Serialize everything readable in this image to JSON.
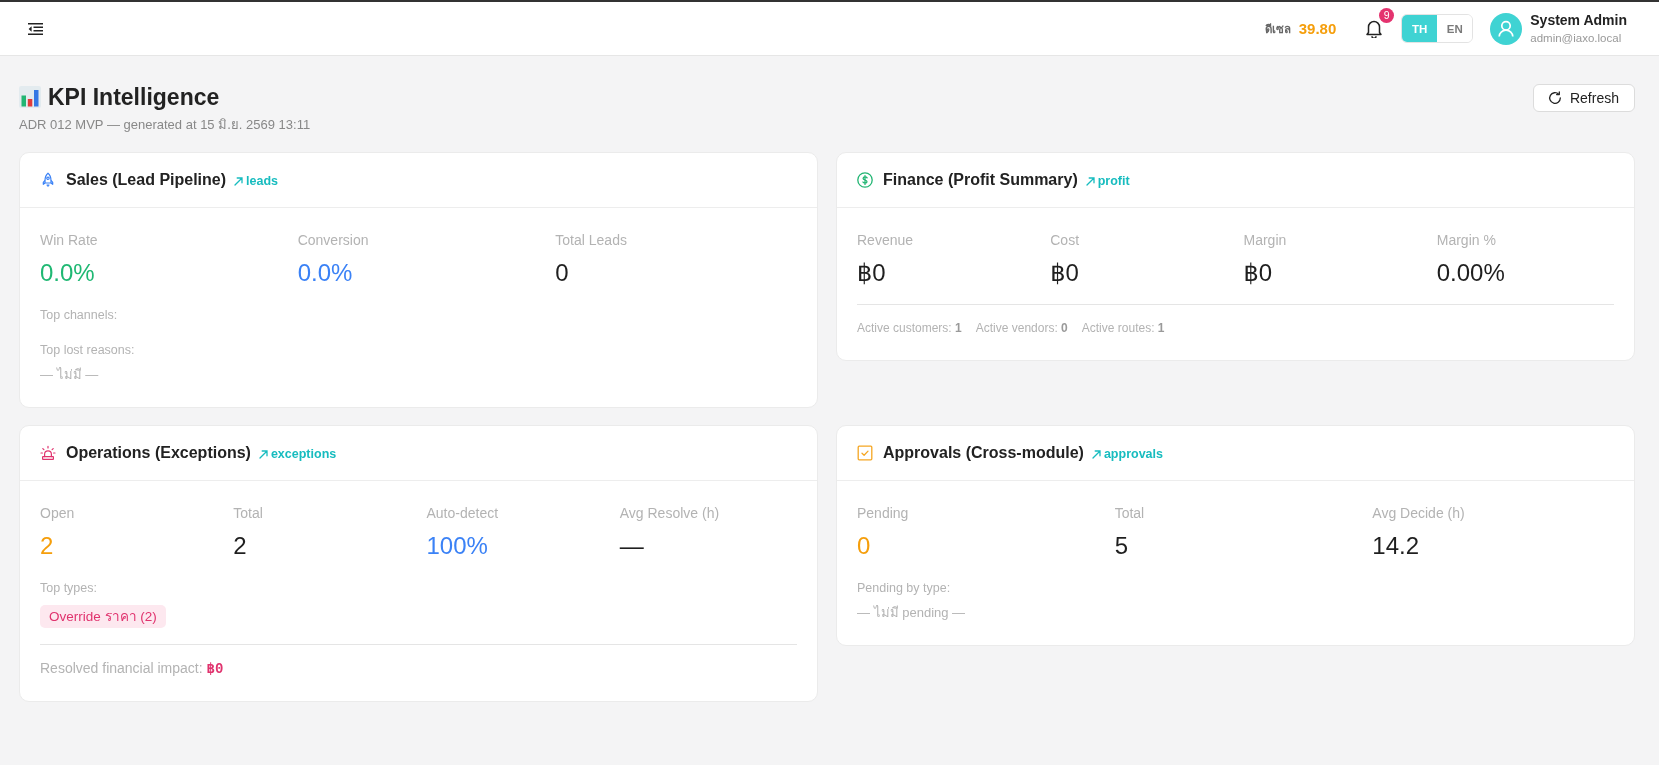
{
  "topbar": {
    "fuel": {
      "label": "ดีเซล",
      "price": "39.80"
    },
    "notifications": {
      "count": "9"
    },
    "languages": [
      {
        "label": "TH",
        "selected": true
      },
      {
        "label": "EN",
        "selected": false
      }
    ],
    "user": {
      "name": "System Admin",
      "email": "admin@iaxo.local"
    }
  },
  "header": {
    "title": "KPI Intelligence",
    "subtitle": "ADR 012 MVP — generated at 15 มิ.ย. 2569 13:11",
    "refresh_button": "Refresh"
  },
  "cards": [
    {
      "kind": "sales",
      "title": "Sales (Lead Pipeline)",
      "link": "leads",
      "metrics": [
        {
          "label": "Win Rate",
          "value": "0.0%",
          "color": "#1fb873"
        },
        {
          "label": "Conversion",
          "value": "0.0%",
          "color": "#3b82f6"
        },
        {
          "label": "Total Leads",
          "value": "0",
          "color": "#1f1f1f"
        }
      ],
      "notes": [
        {
          "kind": "heading",
          "text": "Top channels:"
        },
        {
          "kind": "heading",
          "text": "Top lost reasons:"
        },
        {
          "kind": "empty",
          "text": "— ไม่มี —"
        }
      ]
    },
    {
      "kind": "finance",
      "title": "Finance (Profit Summary)",
      "link": "profit",
      "metrics": [
        {
          "label": "Revenue",
          "value": "฿0",
          "color": "#1f1f1f"
        },
        {
          "label": "Cost",
          "value": "฿0",
          "color": "#1f1f1f"
        },
        {
          "label": "Margin",
          "value": "฿0",
          "color": "#1f1f1f"
        },
        {
          "label": "Margin %",
          "value": "0.00%",
          "color": "#1f1f1f"
        }
      ],
      "footer": [
        {
          "kind": "count",
          "label": "Active customers:",
          "value": "1"
        },
        {
          "kind": "count",
          "label": "Active vendors:",
          "value": "0"
        },
        {
          "kind": "count",
          "label": "Active routes:",
          "value": "1"
        }
      ]
    },
    {
      "kind": "operations",
      "title": "Operations (Exceptions)",
      "link": "exceptions",
      "metrics": [
        {
          "label": "Open",
          "value": "2",
          "color": "#f59e0b"
        },
        {
          "label": "Total",
          "value": "2",
          "color": "#1f1f1f"
        },
        {
          "label": "Auto-detect",
          "value": "100%",
          "color": "#3b82f6"
        },
        {
          "label": "Avg Resolve (h)",
          "value": "—",
          "color": "#1f1f1f"
        }
      ],
      "notes": [
        {
          "kind": "heading",
          "text": "Top types:"
        },
        {
          "kind": "tags",
          "tags": [
            "Override ราคา (2)"
          ]
        }
      ],
      "footer": [
        {
          "kind": "amount",
          "label": "Resolved financial impact:",
          "value": "฿0"
        }
      ]
    },
    {
      "kind": "approvals",
      "title": "Approvals (Cross-module)",
      "link": "approvals",
      "metrics": [
        {
          "label": "Pending",
          "value": "0",
          "color": "#f59e0b"
        },
        {
          "label": "Total",
          "value": "5",
          "color": "#1f1f1f"
        },
        {
          "label": "Avg Decide (h)",
          "value": "14.2",
          "color": "#1f1f1f"
        }
      ],
      "notes": [
        {
          "kind": "heading",
          "text": "Pending by type:"
        },
        {
          "kind": "empty",
          "text": "— ไม่มี pending —"
        }
      ]
    }
  ]
}
